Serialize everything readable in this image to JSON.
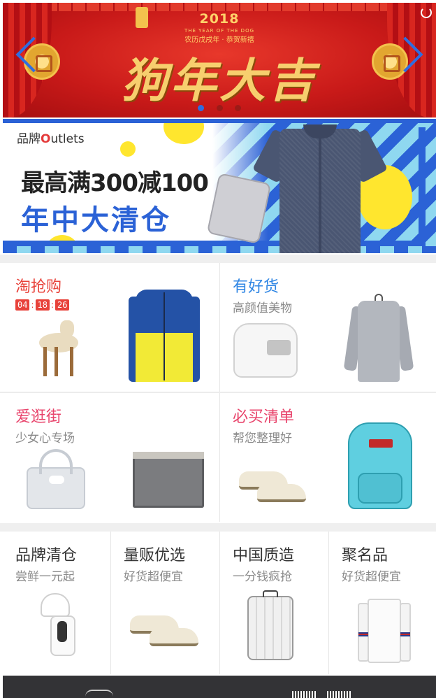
{
  "banner": {
    "year": "2018",
    "year_en": "THE YEAR OF THE DOG",
    "year_cn": "农历戊戌年 · 恭贺新禧",
    "title": "狗年大吉",
    "slide_count": 3,
    "active_slide": 1
  },
  "promo": {
    "brand_prefix": "品牌",
    "brand_o": "O",
    "brand_suffix": "utlets",
    "line1": "最高满300减100",
    "line2": "年中大清仓"
  },
  "grid_top": [
    {
      "title": "淘抢购",
      "timer": [
        "04",
        "18",
        "26"
      ],
      "timer_sep": ":"
    },
    {
      "title": "有好货",
      "subtitle": "高颜值美物"
    }
  ],
  "grid_middle": [
    {
      "title": "爱逛街",
      "subtitle": "少女心专场"
    },
    {
      "title": "必买清单",
      "subtitle": "帮您整理好"
    }
  ],
  "grid_bottom": [
    {
      "title": "品牌清仓",
      "subtitle": "尝鲜一元起"
    },
    {
      "title": "量贩优选",
      "subtitle": "好货超便宜"
    },
    {
      "title": "中国质造",
      "subtitle": "一分钱疯抢"
    },
    {
      "title": "聚名品",
      "subtitle": "好货超便宜"
    }
  ],
  "colors": {
    "accent_red": "#e8423a",
    "accent_blue": "#2f86e4",
    "accent_pink": "#e8436b",
    "promo_blue": "#2b62d6"
  }
}
